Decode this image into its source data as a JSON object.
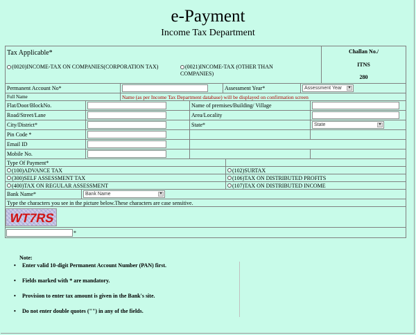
{
  "header": {
    "title": "e-Payment",
    "subtitle": "Income Tax Department"
  },
  "tax_applicable": {
    "label": "Tax Applicable*",
    "option_a": "(0020)INCOME-TAX ON COMPANIES(CORPORATION TAX)",
    "option_b": "(0021)INCOME-TAX (OTHER THAN COMPANIES)"
  },
  "challan": {
    "label": "Challan No./",
    "itns": "ITNS",
    "number": "280"
  },
  "pan": {
    "label": "Permanent Account No*",
    "value": ""
  },
  "assessment_year": {
    "label": "Assessment Year*",
    "selected": "Assessment Year"
  },
  "full_name": {
    "label": "Full Name",
    "note": "Name (as per Income Tax Department database) will be displayed on confirmation screen"
  },
  "address": {
    "flat_label": "Flat/Door/BlockNo.",
    "premises_label": "Name of premises/Building/ Village",
    "road_label": "Road/Street/Lane",
    "area_label": "Area/Locality",
    "city_label": "City/District*",
    "state_label": "State*",
    "state_selected": "State",
    "pin_label": "Pin Code *",
    "email_label": "Email ID",
    "mobile_label": "Mobile No."
  },
  "payment_type": {
    "label": "Type Of Payment*",
    "opt_100": "(100)ADVANCE TAX",
    "opt_102": "(102)SURTAX",
    "opt_300": "(300)SELF ASSESSMENT TAX",
    "opt_106": "(106)TAX ON DISTRIBUTED PROFITS",
    "opt_400": "(400)TAX ON REGULAR ASSESSMENT",
    "opt_107": "(107)TAX ON DISTRIBUTED INCOME"
  },
  "bank": {
    "label": "Bank Name*",
    "selected": "Bank Name"
  },
  "captcha": {
    "instruction": "Type the characters you see in the picture below.These characters are case sensitive.",
    "image_text": "WT7RS",
    "required_mark": "*"
  },
  "notes": {
    "heading": "Note:",
    "items": [
      "Enter valid 10-digit Permanent Account Number (PAN) first.",
      "Fields marked with * are mandatory.",
      "Provision to enter tax amount is given in the Bank's site.",
      "Do not enter double quotes (\"\") in any of the fields."
    ]
  }
}
